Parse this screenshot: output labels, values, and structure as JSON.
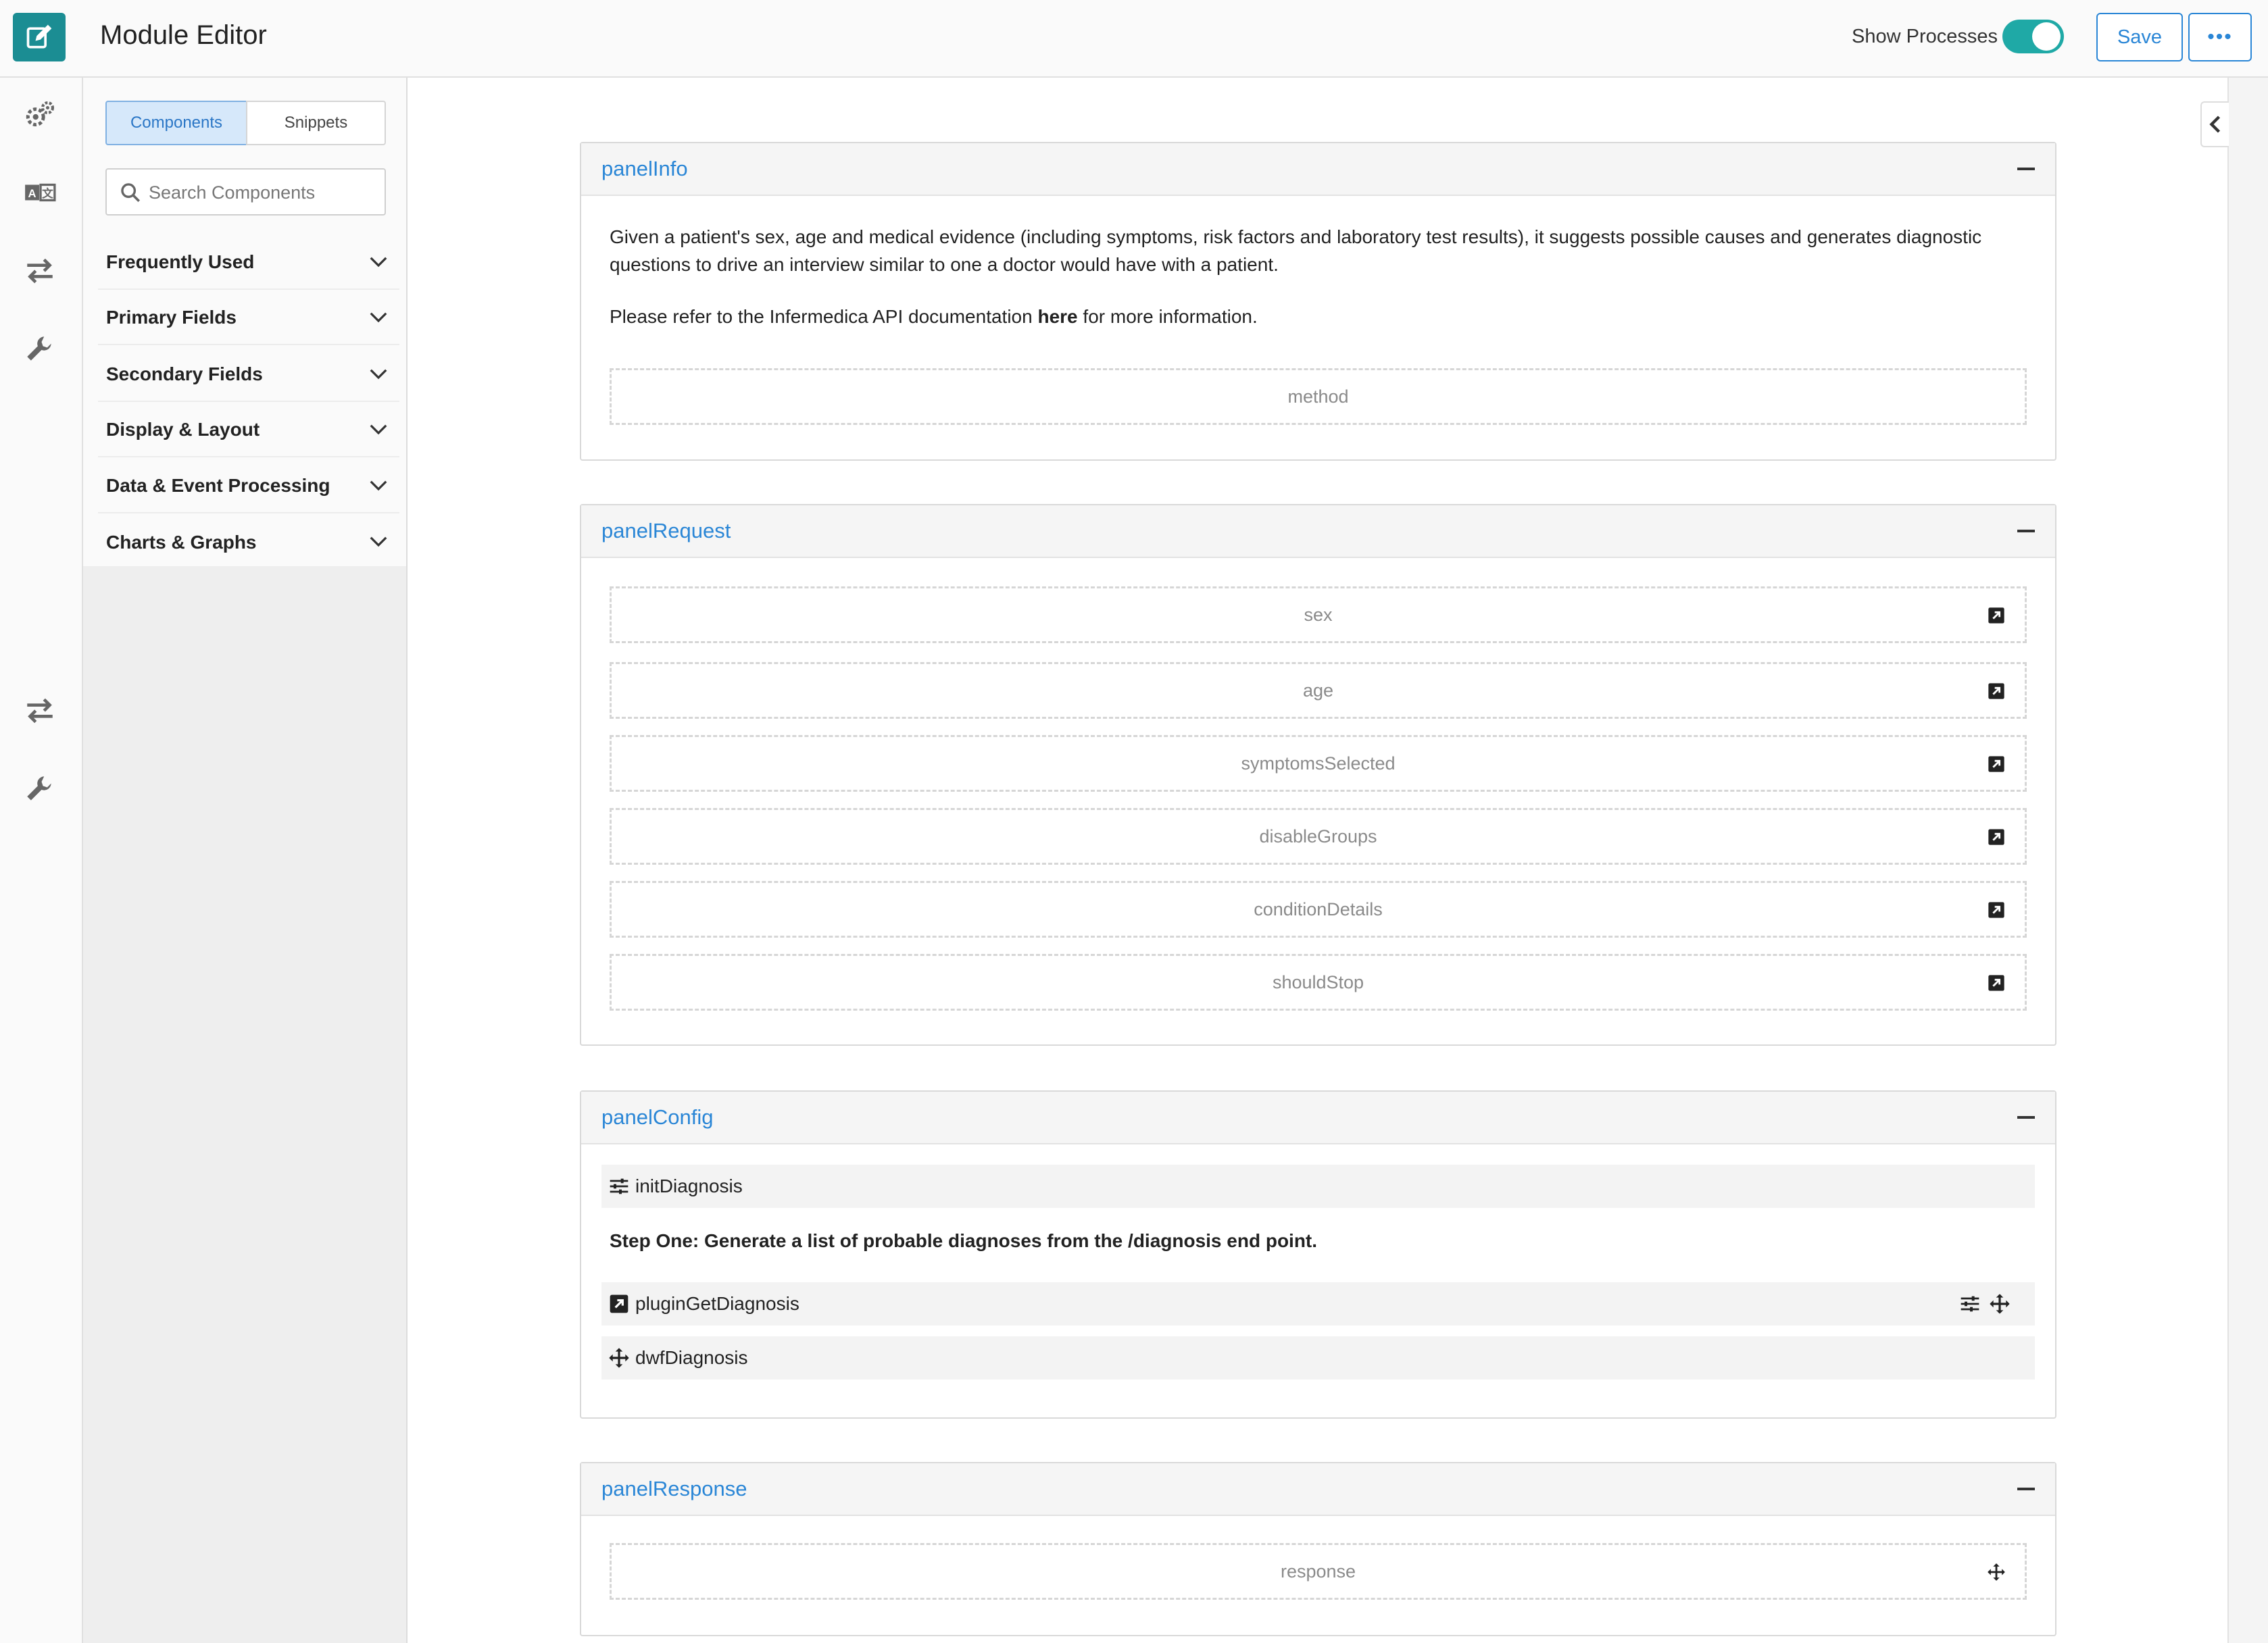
{
  "header": {
    "title": "Module Editor",
    "toggle_label": "Show Processes",
    "toggle_on": true,
    "save_label": "Save",
    "more_label": "•••"
  },
  "rail": {
    "icons": [
      "edit-icon",
      "gears-icon",
      "translate-icon",
      "transfer-icon",
      "wrench-icon",
      "transfer-icon",
      "wrench-icon"
    ]
  },
  "components_panel": {
    "tabs": [
      {
        "label": "Components",
        "active": true
      },
      {
        "label": "Snippets",
        "active": false
      }
    ],
    "search_placeholder": "Search Components",
    "categories": [
      {
        "label": "Frequently Used"
      },
      {
        "label": "Primary Fields"
      },
      {
        "label": "Secondary Fields"
      },
      {
        "label": "Display & Layout"
      },
      {
        "label": "Data & Event Processing"
      },
      {
        "label": "Charts & Graphs"
      }
    ]
  },
  "panels": {
    "info": {
      "title": "panelInfo",
      "paragraph1_line1": "Given a patient's sex, age and medical evidence (including symptoms, risk factors and laboratory test results), it suggests possible causes and generates diagnostic",
      "paragraph1_line2": "questions to drive an interview similar to one a doctor would have with a patient.",
      "paragraph2_before": "Please refer to the Infermedica API documentation ",
      "paragraph2_link": "here",
      "paragraph2_after": " for more information.",
      "fields": [
        "method"
      ]
    },
    "request": {
      "title": "panelRequest",
      "fields": [
        "sex",
        "age",
        "symptomsSelected",
        "disableGroups",
        "conditionDetails",
        "shouldStop"
      ]
    },
    "config": {
      "title": "panelConfig",
      "process1": "initDiagnosis",
      "step_text": "Step One: Generate a list of probable diagnoses from the /diagnosis end point.",
      "process2": "pluginGetDiagnosis",
      "process3": "dwfDiagnosis"
    },
    "response": {
      "title": "panelResponse",
      "fields": [
        "response"
      ]
    }
  },
  "colors": {
    "brand": "#1b8d93",
    "accent": "#2a86d6",
    "toggle": "#1fa9a6"
  }
}
